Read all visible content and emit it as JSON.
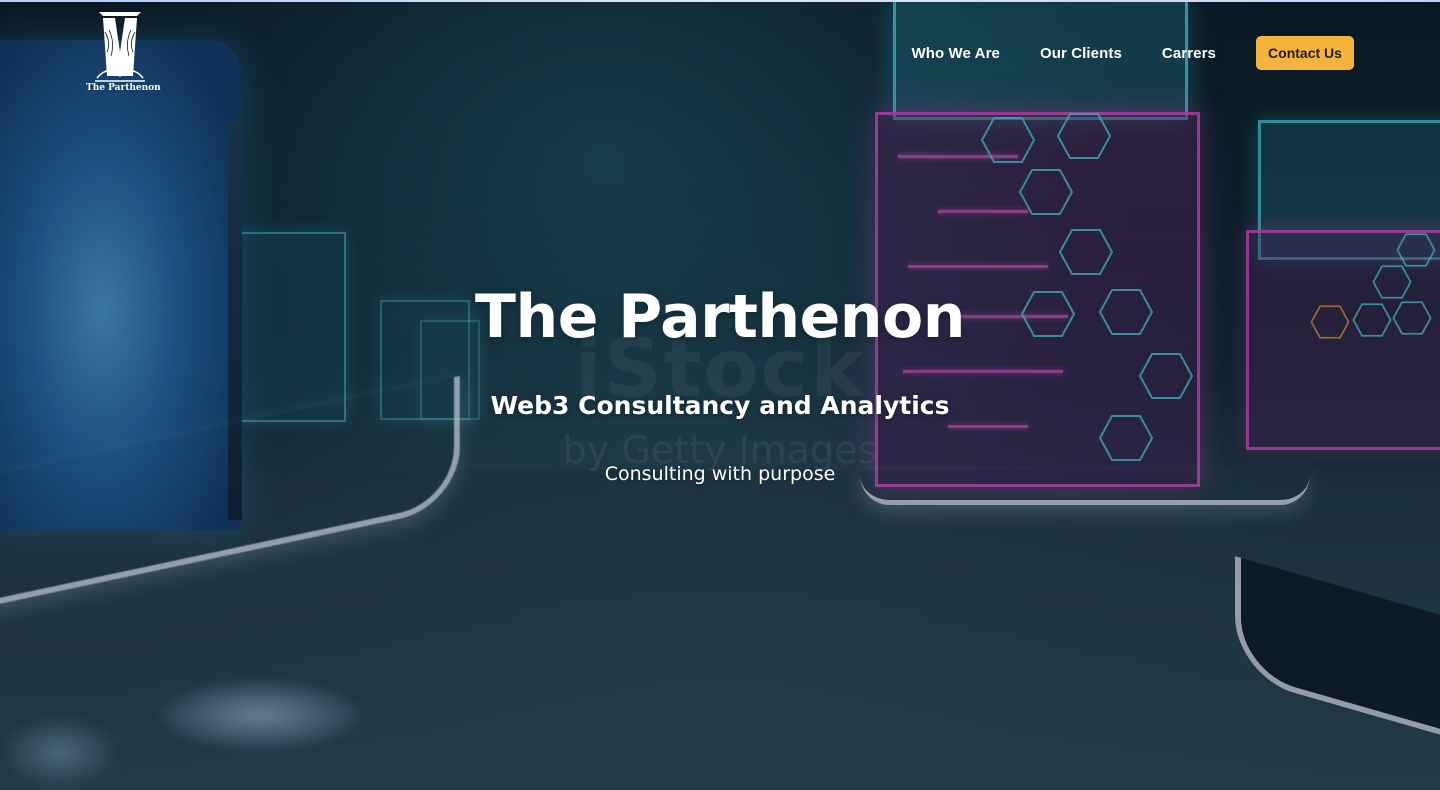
{
  "logo": {
    "text": "The Parthenon",
    "icon": "parthenon-logo-icon"
  },
  "nav": {
    "links": [
      {
        "label": "Who We Are"
      },
      {
        "label": "Our Clients"
      },
      {
        "label": "Carrers"
      }
    ],
    "contact_label": "Contact Us"
  },
  "hero": {
    "title": "The Parthenon",
    "subtitle": "Web3 Consultancy and Analytics",
    "tagline": "Consulting with purpose"
  },
  "watermark": {
    "line1": "iStock",
    "line2": "by Getty Images"
  },
  "colors": {
    "accent": "#f5b43c",
    "neon_cyan": "#50e6f0",
    "neon_pink": "#eb50d2",
    "background": "#0d1f2c"
  }
}
